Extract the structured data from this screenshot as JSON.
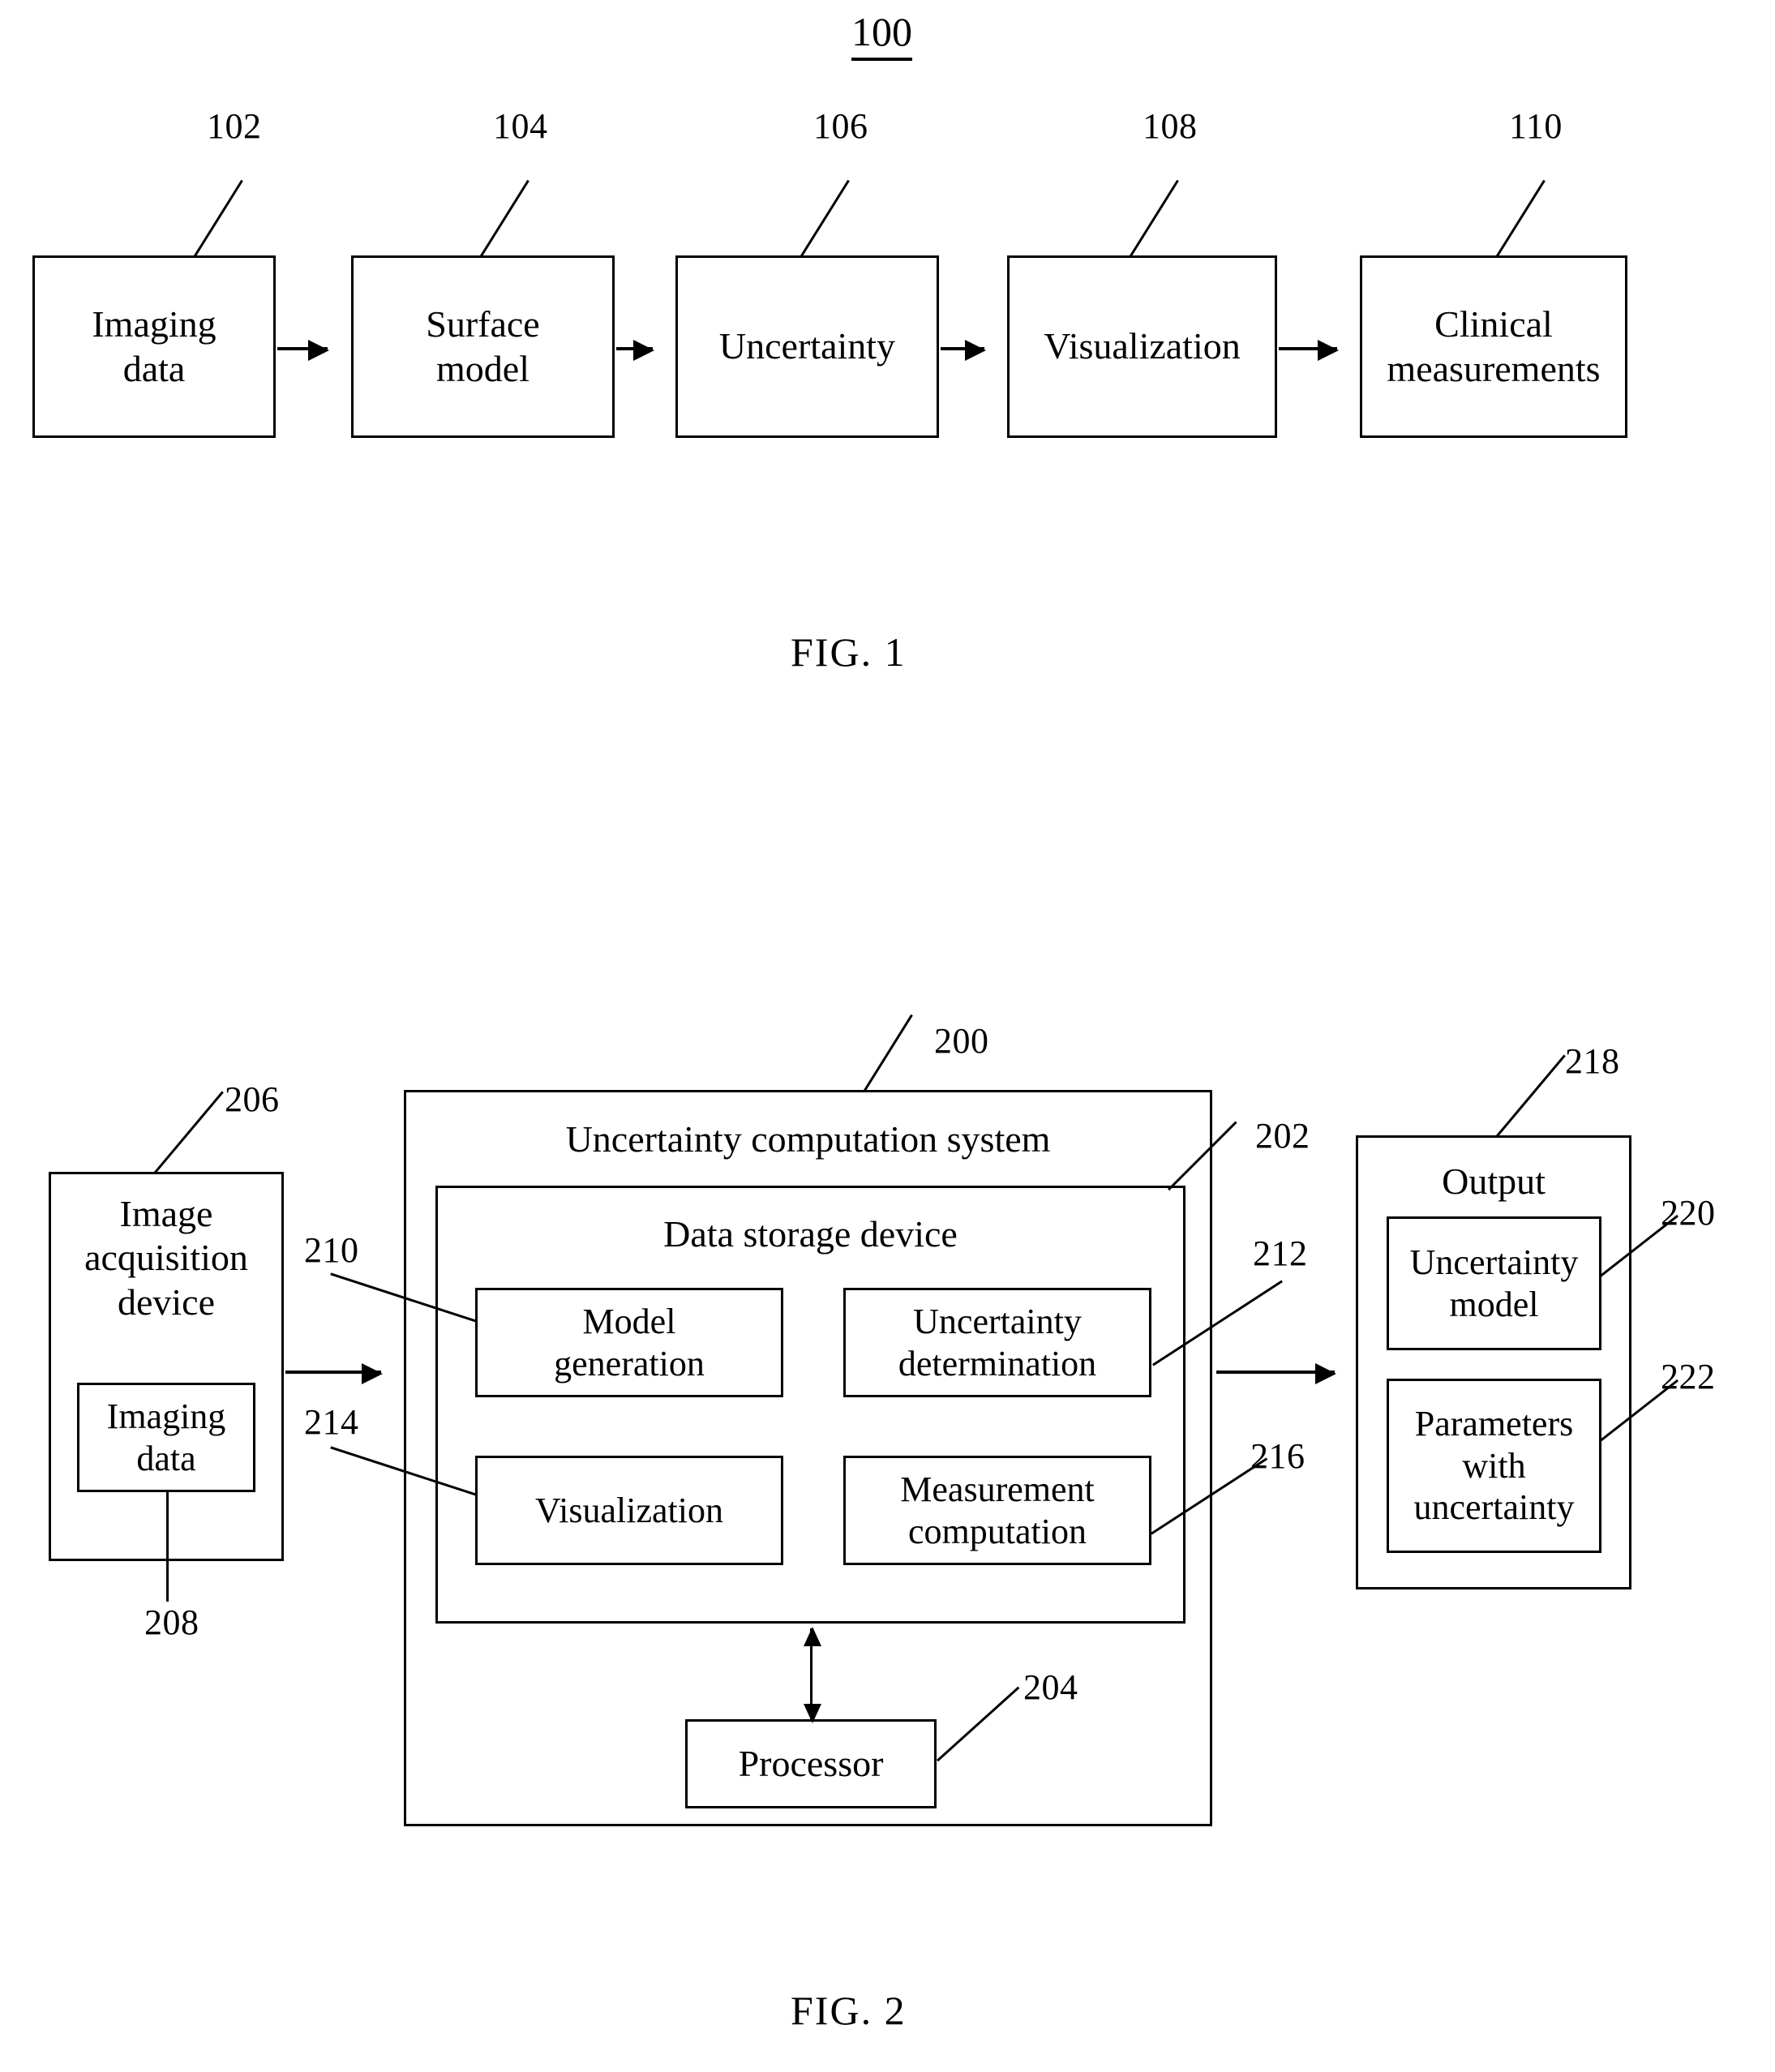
{
  "figure1": {
    "system_number": "100",
    "caption": "FIG. 1",
    "blocks": [
      {
        "ref": "102",
        "label": "Imaging\ndata"
      },
      {
        "ref": "104",
        "label": "Surface\nmodel"
      },
      {
        "ref": "106",
        "label": "Uncertainty"
      },
      {
        "ref": "108",
        "label": "Visualization"
      },
      {
        "ref": "110",
        "label": "Clinical\nmeasurements"
      }
    ]
  },
  "figure2": {
    "caption": "FIG. 2",
    "system": {
      "ref": "200",
      "title": "Uncertainty computation system"
    },
    "storage": {
      "ref": "202",
      "title": "Data storage device",
      "modules": [
        {
          "ref": "210",
          "label": "Model\ngeneration"
        },
        {
          "ref": "212",
          "label": "Uncertainty\ndetermination"
        },
        {
          "ref": "214",
          "label": "Visualization"
        },
        {
          "ref": "216",
          "label": "Measurement\ncomputation"
        }
      ]
    },
    "processor": {
      "ref": "204",
      "label": "Processor"
    },
    "acquisition": {
      "ref": "206",
      "label": "Image\nacquisition\ndevice",
      "inner": {
        "ref": "208",
        "label": "Imaging\ndata"
      }
    },
    "output": {
      "ref": "218",
      "title": "Output",
      "items": [
        {
          "ref": "220",
          "label": "Uncertainty\nmodel"
        },
        {
          "ref": "222",
          "label": "Parameters\nwith\nuncertainty"
        }
      ]
    }
  }
}
